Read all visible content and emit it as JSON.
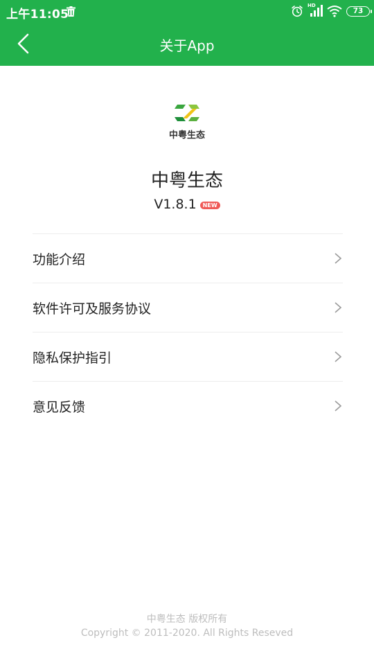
{
  "status_bar": {
    "time": "上午11:05",
    "network_hd": "HD",
    "battery": "73"
  },
  "header": {
    "title": "关于App"
  },
  "logo": {
    "text": "中粤生态"
  },
  "app": {
    "name": "中粤生态",
    "version": "V1.8.1",
    "badge": "NEW"
  },
  "menu": [
    {
      "label": "功能介绍"
    },
    {
      "label": "软件许可及服务协议"
    },
    {
      "label": "隐私保护指引"
    },
    {
      "label": "意见反馈"
    }
  ],
  "footer": {
    "line1": "中粤生态 版权所有",
    "line2": "Copyright © 2011-2020. All Rights Reseved"
  },
  "colors": {
    "header_bg": "#22b14c",
    "badge_bg": "#ef5a57"
  }
}
